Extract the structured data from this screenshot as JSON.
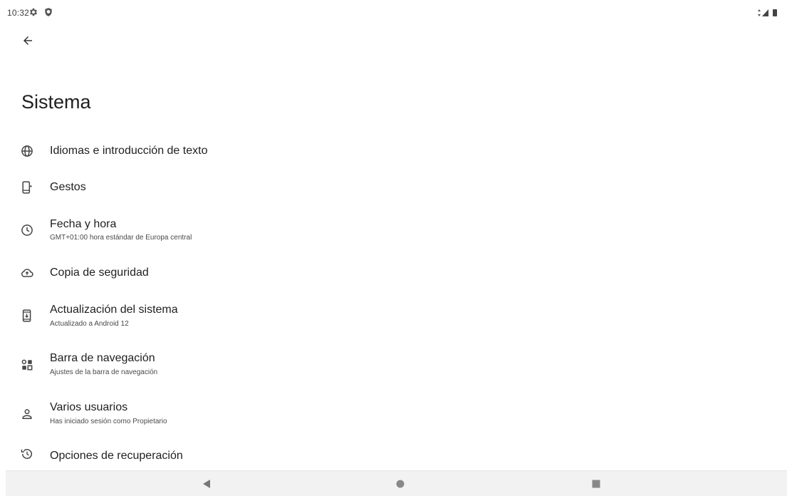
{
  "status_bar": {
    "time": "10:32",
    "left_icons": [
      "gear-icon",
      "shield-icon"
    ],
    "right_icons": [
      "data-arrows-icon",
      "signal-icon",
      "battery-icon"
    ]
  },
  "header": {
    "back_icon": "arrow-back-icon",
    "title": "Sistema"
  },
  "items": [
    {
      "icon": "globe-icon",
      "title": "Idiomas e introducción de texto",
      "summary": ""
    },
    {
      "icon": "gesture-phone-icon",
      "title": "Gestos",
      "summary": ""
    },
    {
      "icon": "clock-icon",
      "title": "Fecha y hora",
      "summary": "GMT+01:00 hora estándar de Europa central"
    },
    {
      "icon": "cloud-upload-icon",
      "title": "Copia de seguridad",
      "summary": ""
    },
    {
      "icon": "system-update-icon",
      "title": "Actualización del sistema",
      "summary": "Actualizado a Android 12"
    },
    {
      "icon": "navigation-bar-icon",
      "title": "Barra de navegación",
      "summary": "Ajustes de la barra de navegación"
    },
    {
      "icon": "user-icon",
      "title": "Varios usuarios",
      "summary": "Has iniciado sesión como Propietario"
    },
    {
      "icon": "restore-history-icon",
      "title": "Opciones de recuperación",
      "summary": ""
    }
  ],
  "nav_bar": {
    "back": "nav-back-icon",
    "home": "nav-home-icon",
    "recents": "nav-recents-icon"
  },
  "colors": {
    "text": "#1f1f1f",
    "summary": "#4a4a4a",
    "icon": "#444444",
    "nav_bg": "#f2f2f2"
  }
}
